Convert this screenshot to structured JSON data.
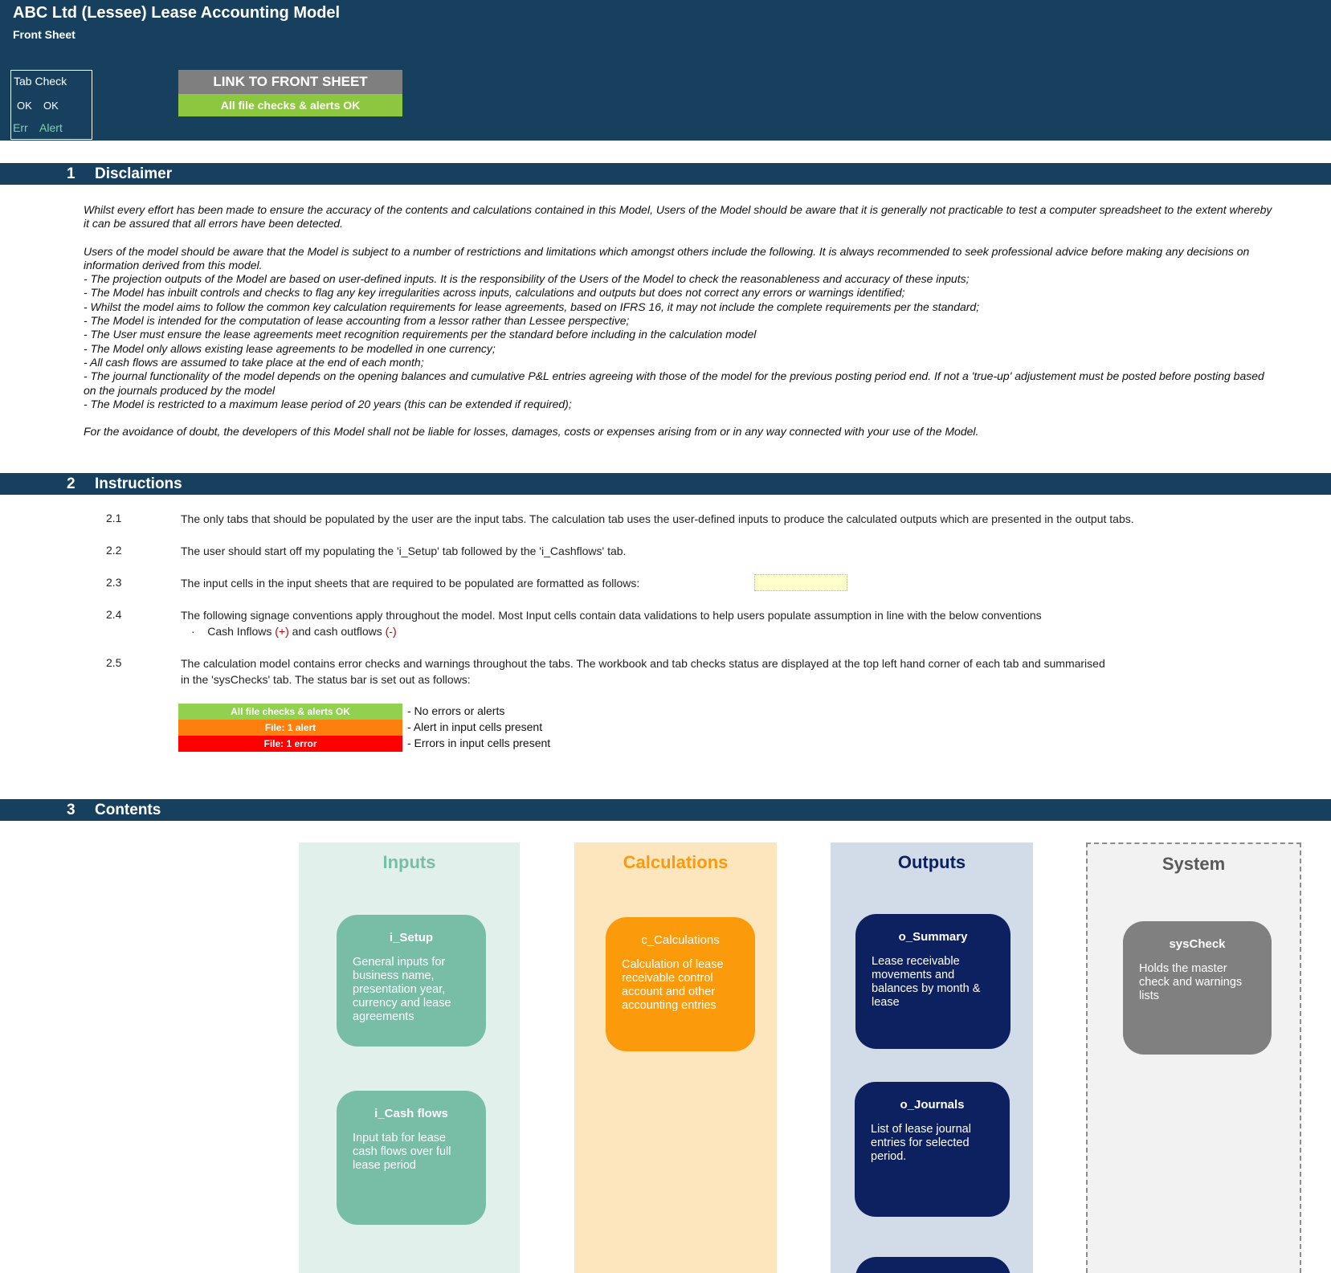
{
  "header": {
    "title": "ABC Ltd (Lessee) Lease Accounting Model",
    "subtitle": "Front Sheet",
    "tab_check": {
      "title": "Tab Check",
      "ok1": "OK",
      "ok2": "OK",
      "err": "Err",
      "alert": "Alert"
    },
    "link_button": "LINK TO FRONT SHEET",
    "status": "All file checks & alerts OK"
  },
  "sections": {
    "disclaimer": {
      "num": "1",
      "title": "Disclaimer"
    },
    "instructions": {
      "num": "2",
      "title": "Instructions"
    },
    "contents": {
      "num": "3",
      "title": "Contents"
    }
  },
  "disclaimer": {
    "p1": "Whilst every effort has been made to ensure the accuracy of the contents and calculations contained in this Model, Users of the Model should be aware that it is generally not practicable to test a computer spreadsheet to the extent whereby it can be assured that all errors have been detected.",
    "p2": "Users of the model should be aware that the Model is subject to a number of restrictions and limitations which amongst others include the following. It is always recommended to seek professional advice before making any decisions on information derived from this model.",
    "bullets": [
      "- The projection outputs of the Model are based on user-defined inputs. It is the responsibility of the Users of the Model to check the reasonableness and accuracy of these inputs;",
      "- The Model has inbuilt controls and checks to flag any key irregularities across inputs, calculations and outputs but does not correct any errors or warnings identified;",
      "- Whilst the model aims to follow the common key calculation requirements for lease agreements, based on IFRS 16, it may not include the complete requirements per the standard;",
      "- The Model is intended for the computation of lease accounting from a lessor rather than Lessee perspective;",
      "- The User must ensure the lease agreements meet recognition requirements per the standard before including in the calculation model",
      "- The Model only allows existing lease agreements to be modelled in one currency;",
      "- All cash flows are assumed to take place at the end of each month;",
      "- The journal functionality of the model depends on the opening balances and cumulative P&L entries agreeing with those of the model for the previous posting period end. If not a 'true-up' adjustement must be posted before posting based on the journals produced by the model",
      "- The Model is restricted to a maximum lease period of 20 years (this can be extended if required);"
    ],
    "p3": "For the avoidance of doubt, the developers of this Model shall not be liable for losses, damages, costs or expenses arising from or in any way connected with your use of the Model."
  },
  "instructions": {
    "items": [
      {
        "num": "2.1",
        "text": "The only tabs that should be populated by the user are the input tabs. The calculation tab uses the user-defined inputs to produce the calculated outputs which are presented in the output tabs."
      },
      {
        "num": "2.2",
        "text": "The user should start off my populating the 'i_Setup' tab followed by the 'i_Cashflows' tab."
      },
      {
        "num": "2.3",
        "text": "The input cells in the input sheets that are required to be populated are formatted as follows:"
      },
      {
        "num": "2.4",
        "text": "The following signage conventions apply throughout the model. Most Input cells contain data validations to help users populate assumption in line with the below conventions"
      },
      {
        "num": "2.5",
        "text": "The calculation model contains error checks and warnings throughout the tabs. The workbook and tab checks status are displayed at the top left hand corner of each tab and summarised",
        "text2": "in the 'sysChecks' tab. The status bar is set out as follows:"
      }
    ],
    "sign": {
      "bullet": "·",
      "part1": "Cash Inflows ",
      "plus": "(+)",
      "part2": " and cash outflows ",
      "minus": "(-)"
    },
    "legend": [
      {
        "bar": "All file checks & alerts OK",
        "color": "#92d050",
        "desc": "- No errors or alerts"
      },
      {
        "bar": "File: 1 alert",
        "color": "#ff7f0e",
        "desc": "- Alert in input cells present"
      },
      {
        "bar": "File: 1 error",
        "color": "#ff0000",
        "desc": "- Errors in input cells present"
      }
    ]
  },
  "contents": {
    "inputs": {
      "title": "Inputs",
      "cards": [
        {
          "title": "i_Setup",
          "desc": "General inputs for business name, presentation year, currency and lease agreements"
        },
        {
          "title": "i_Cash flows",
          "desc": "Input tab for lease cash flows over full lease period"
        }
      ]
    },
    "calculations": {
      "title": "Calculations",
      "cards": [
        {
          "title": "c_Calculations",
          "desc": "Calculation of lease receivable control account and other accounting entries"
        }
      ]
    },
    "outputs": {
      "title": "Outputs",
      "cards": [
        {
          "title": "o_Summary",
          "desc": "Lease receivable movements and balances by month & lease"
        },
        {
          "title": "o_Journals",
          "desc": "List of lease journal entries for selected period."
        }
      ]
    },
    "system": {
      "title": "System",
      "cards": [
        {
          "title": "sysCheck",
          "desc": "Holds the master check and warnings lists"
        }
      ]
    }
  },
  "colors": {
    "header": "#17405f",
    "status_ok": "#8dc63f",
    "inputs_bg": "#e2f0eb",
    "inputs_card": "#78bda6",
    "calc_bg": "#fde6bd",
    "calc_card": "#fb9a0b",
    "outputs_bg": "#d1dce8",
    "outputs_card": "#0d2160",
    "system_bg": "#f2f2f2",
    "system_card": "#808080"
  }
}
